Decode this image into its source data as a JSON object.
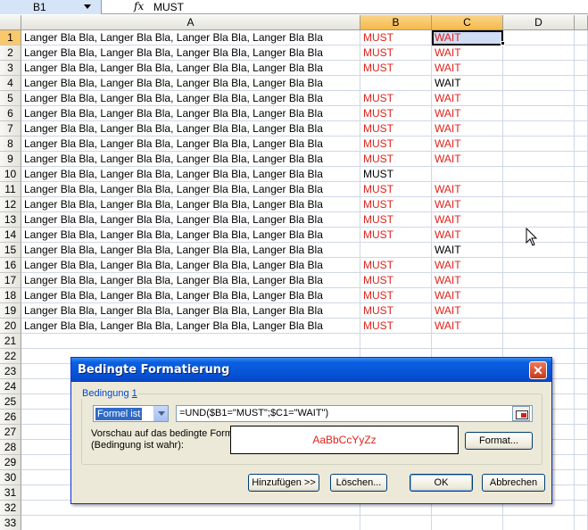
{
  "formula_bar": {
    "name_box": "B1",
    "fx_icon": "fx",
    "formula": "MUST"
  },
  "columns": [
    "A",
    "B",
    "C",
    "D"
  ],
  "rows": [
    {
      "num": "1",
      "a": "Langer Bla Bla, Langer Bla Bla, Langer Bla Bla, Langer Bla Bla",
      "b": "MUST",
      "c": "WAIT",
      "b_red": true,
      "c_red": true
    },
    {
      "num": "2",
      "a": "Langer Bla Bla, Langer Bla Bla, Langer Bla Bla, Langer Bla Bla",
      "b": "MUST",
      "c": "WAIT",
      "b_red": true,
      "c_red": true
    },
    {
      "num": "3",
      "a": "Langer Bla Bla, Langer Bla Bla, Langer Bla Bla, Langer Bla Bla",
      "b": "MUST",
      "c": "WAIT",
      "b_red": true,
      "c_red": true
    },
    {
      "num": "4",
      "a": "Langer Bla Bla, Langer Bla Bla, Langer Bla Bla, Langer Bla Bla",
      "b": "",
      "c": "WAIT",
      "b_red": false,
      "c_red": false
    },
    {
      "num": "5",
      "a": "Langer Bla Bla, Langer Bla Bla, Langer Bla Bla, Langer Bla Bla",
      "b": "MUST",
      "c": "WAIT",
      "b_red": true,
      "c_red": true
    },
    {
      "num": "6",
      "a": "Langer Bla Bla, Langer Bla Bla, Langer Bla Bla, Langer Bla Bla",
      "b": "MUST",
      "c": "WAIT",
      "b_red": true,
      "c_red": true
    },
    {
      "num": "7",
      "a": "Langer Bla Bla, Langer Bla Bla, Langer Bla Bla, Langer Bla Bla",
      "b": "MUST",
      "c": "WAIT",
      "b_red": true,
      "c_red": true
    },
    {
      "num": "8",
      "a": "Langer Bla Bla, Langer Bla Bla, Langer Bla Bla, Langer Bla Bla",
      "b": "MUST",
      "c": "WAIT",
      "b_red": true,
      "c_red": true
    },
    {
      "num": "9",
      "a": "Langer Bla Bla, Langer Bla Bla, Langer Bla Bla, Langer Bla Bla",
      "b": "MUST",
      "c": "WAIT",
      "b_red": true,
      "c_red": true
    },
    {
      "num": "10",
      "a": "Langer Bla Bla, Langer Bla Bla, Langer Bla Bla, Langer Bla Bla",
      "b": "MUST",
      "c": "",
      "b_red": false,
      "c_red": false
    },
    {
      "num": "11",
      "a": "Langer Bla Bla, Langer Bla Bla, Langer Bla Bla, Langer Bla Bla",
      "b": "MUST",
      "c": "WAIT",
      "b_red": true,
      "c_red": true
    },
    {
      "num": "12",
      "a": "Langer Bla Bla, Langer Bla Bla, Langer Bla Bla, Langer Bla Bla",
      "b": "MUST",
      "c": "WAIT",
      "b_red": true,
      "c_red": true
    },
    {
      "num": "13",
      "a": "Langer Bla Bla, Langer Bla Bla, Langer Bla Bla, Langer Bla Bla",
      "b": "MUST",
      "c": "WAIT",
      "b_red": true,
      "c_red": true
    },
    {
      "num": "14",
      "a": "Langer Bla Bla, Langer Bla Bla, Langer Bla Bla, Langer Bla Bla",
      "b": "MUST",
      "c": "WAIT",
      "b_red": true,
      "c_red": true
    },
    {
      "num": "15",
      "a": "Langer Bla Bla, Langer Bla Bla, Langer Bla Bla, Langer Bla Bla",
      "b": "",
      "c": "WAIT",
      "b_red": false,
      "c_red": false
    },
    {
      "num": "16",
      "a": "Langer Bla Bla, Langer Bla Bla, Langer Bla Bla, Langer Bla Bla",
      "b": "MUST",
      "c": "WAIT",
      "b_red": true,
      "c_red": true
    },
    {
      "num": "17",
      "a": "Langer Bla Bla, Langer Bla Bla, Langer Bla Bla, Langer Bla Bla",
      "b": "MUST",
      "c": "WAIT",
      "b_red": true,
      "c_red": true
    },
    {
      "num": "18",
      "a": "Langer Bla Bla, Langer Bla Bla, Langer Bla Bla, Langer Bla Bla",
      "b": "MUST",
      "c": "WAIT",
      "b_red": true,
      "c_red": true
    },
    {
      "num": "19",
      "a": "Langer Bla Bla, Langer Bla Bla, Langer Bla Bla, Langer Bla Bla",
      "b": "MUST",
      "c": "WAIT",
      "b_red": true,
      "c_red": true
    },
    {
      "num": "20",
      "a": "Langer Bla Bla, Langer Bla Bla, Langer Bla Bla, Langer Bla Bla",
      "b": "MUST",
      "c": "WAIT",
      "b_red": true,
      "c_red": true
    },
    {
      "num": "21",
      "a": "",
      "b": "",
      "c": "",
      "b_red": false,
      "c_red": false
    },
    {
      "num": "22",
      "a": "",
      "b": "",
      "c": "",
      "b_red": false,
      "c_red": false
    },
    {
      "num": "23",
      "a": "",
      "b": "",
      "c": "",
      "b_red": false,
      "c_red": false
    },
    {
      "num": "24",
      "a": "",
      "b": "",
      "c": "",
      "b_red": false,
      "c_red": false
    },
    {
      "num": "25",
      "a": "",
      "b": "",
      "c": "",
      "b_red": false,
      "c_red": false
    },
    {
      "num": "26",
      "a": "",
      "b": "",
      "c": "",
      "b_red": false,
      "c_red": false
    },
    {
      "num": "27",
      "a": "",
      "b": "",
      "c": "",
      "b_red": false,
      "c_red": false
    },
    {
      "num": "28",
      "a": "",
      "b": "",
      "c": "",
      "b_red": false,
      "c_red": false
    },
    {
      "num": "29",
      "a": "",
      "b": "",
      "c": "",
      "b_red": false,
      "c_red": false
    },
    {
      "num": "30",
      "a": "",
      "b": "",
      "c": "",
      "b_red": false,
      "c_red": false
    },
    {
      "num": "31",
      "a": "",
      "b": "",
      "c": "",
      "b_red": false,
      "c_red": false
    },
    {
      "num": "32",
      "a": "",
      "b": "",
      "c": "",
      "b_red": false,
      "c_red": false
    },
    {
      "num": "33",
      "a": "",
      "b": "",
      "c": "",
      "b_red": false,
      "c_red": false
    }
  ],
  "colors": {
    "conditional_red": "#e0221b",
    "selected_header": "#f5b94a",
    "title_bar": "#0553d6"
  },
  "dialog": {
    "title": "Bedingte Formatierung",
    "close_icon": "close-x",
    "condition_label": "Bedingung",
    "condition_number": "1",
    "type_value": "Formel ist",
    "formula_value": "=UND($B1=\"MUST\";$C1=\"WAIT\")",
    "preview_label": "Vorschau auf das bedingte Format (Bedingung ist wahr):",
    "preview_text": "AaBbCcYyZz",
    "format_button": "Format...",
    "add_button": "Hinzufügen >>",
    "delete_button": "Löschen...",
    "ok_button": "OK",
    "cancel_button": "Abbrechen"
  }
}
